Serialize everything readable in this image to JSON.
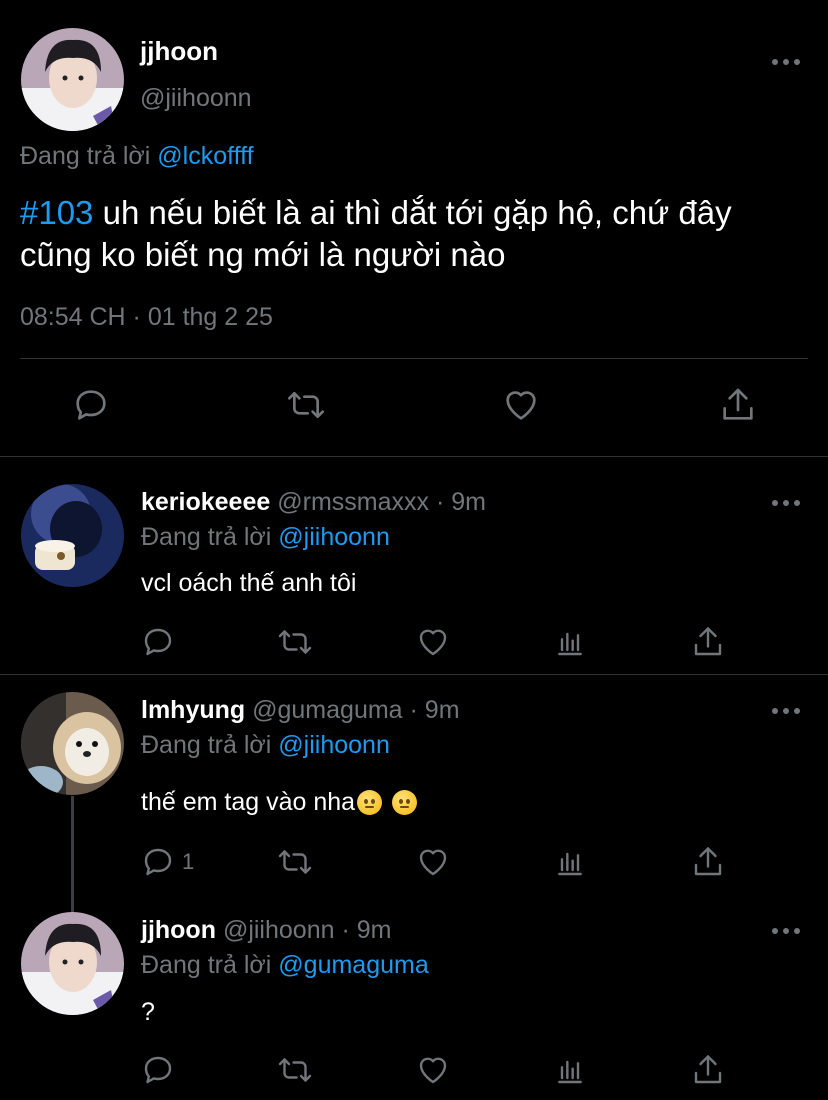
{
  "main_tweet": {
    "name": "jjhoon",
    "handle": "@jiihoonn",
    "replying_prefix": "Đang trả lời",
    "replying_to": "@lckoffff",
    "hashtag": "#103",
    "text": " uh nếu biết là ai thì dắt tới gặp hộ, chứ đây cũng ko biết ng mới là người nào",
    "timestamp": "08:54 CH · 01 thg 2 25",
    "actions": [
      "reply-icon",
      "retweet-icon",
      "like-icon",
      "share-icon"
    ]
  },
  "replies": [
    {
      "name": "keriokeeee",
      "handle": "@rmssmaxxx",
      "time": "· 9m",
      "replying_prefix": "Đang trả lời",
      "replying_to": "@jiihoonn",
      "text": "vcl oách thế anh tôi",
      "reply_count": "",
      "avatar_colors": [
        "#1b2a5e",
        "#3b4c8f",
        "#0e1530"
      ]
    },
    {
      "name": "lmhyung",
      "handle": "@gumaguma",
      "time": "· 9m",
      "replying_prefix": "Đang trả lời",
      "replying_to": "@jiihoonn",
      "text": "thế em tag vào nha",
      "emoji": "slightly-frowning-face",
      "reply_count": "1",
      "avatar_colors": [
        "#d9c3a0",
        "#8a6a44",
        "#f1ede4"
      ]
    },
    {
      "name": "jjhoon",
      "handle": "@jiihoonn",
      "time": "· 9m",
      "replying_prefix": "Đang trả lời",
      "replying_to": "@gumaguma",
      "text": "?",
      "reply_count": "",
      "avatar_colors": [
        "#2a2a2e",
        "#e8d8cf",
        "#5a4a6e"
      ]
    }
  ],
  "colors": {
    "background": "#000000",
    "link": "#1d9bf0",
    "muted": "#71767b",
    "divider": "#2f3336"
  }
}
